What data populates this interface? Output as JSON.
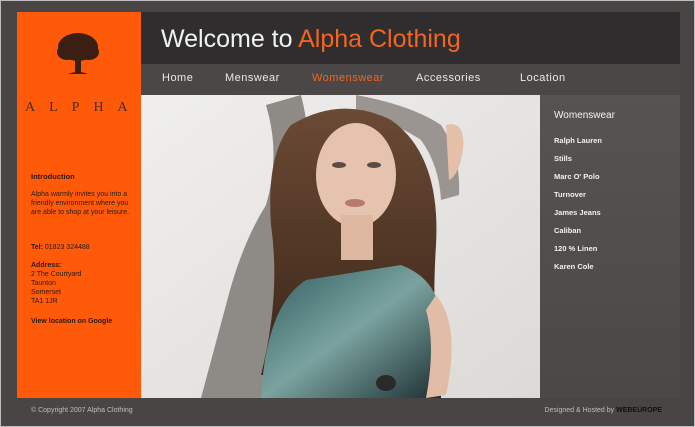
{
  "logo": {
    "word": "ALPHA"
  },
  "intro": {
    "heading": "Introduction",
    "text": "Alpha warmly invites you into a friendly environment where you are able to shop at your leisure.",
    "tel_label": "Tel:",
    "tel_value": "01823 324488",
    "address_label": "Address:",
    "address_lines": [
      "2 The Courtyard",
      "Taunton",
      "Somerset",
      "TA1 1JR"
    ],
    "map_link": "View location on Google"
  },
  "header": {
    "title_plain": "Welcome to ",
    "title_accent": "Alpha Clothing"
  },
  "nav": {
    "items": [
      {
        "label": "Home"
      },
      {
        "label": "Menswear"
      },
      {
        "label": "Womenswear",
        "active": true
      },
      {
        "label": "Accessories"
      },
      {
        "label": "Location"
      }
    ]
  },
  "right_panel": {
    "heading": "Womenswear",
    "brands": [
      "Ralph Lauren",
      "Stills",
      "Marc O' Polo",
      "Turnover",
      "James Jeans",
      "Caliban",
      "120 % Linen",
      "Karen Cole"
    ]
  },
  "footer": {
    "copyright": "© Copyright 2007  Alpha Clothing",
    "credit_text": "Designed & Hosted by ",
    "credit_brand": "WEBEUROPE"
  },
  "colors": {
    "accent": "#f26522",
    "sidebar": "#ff5a0a",
    "header": "#2f2d2d"
  }
}
